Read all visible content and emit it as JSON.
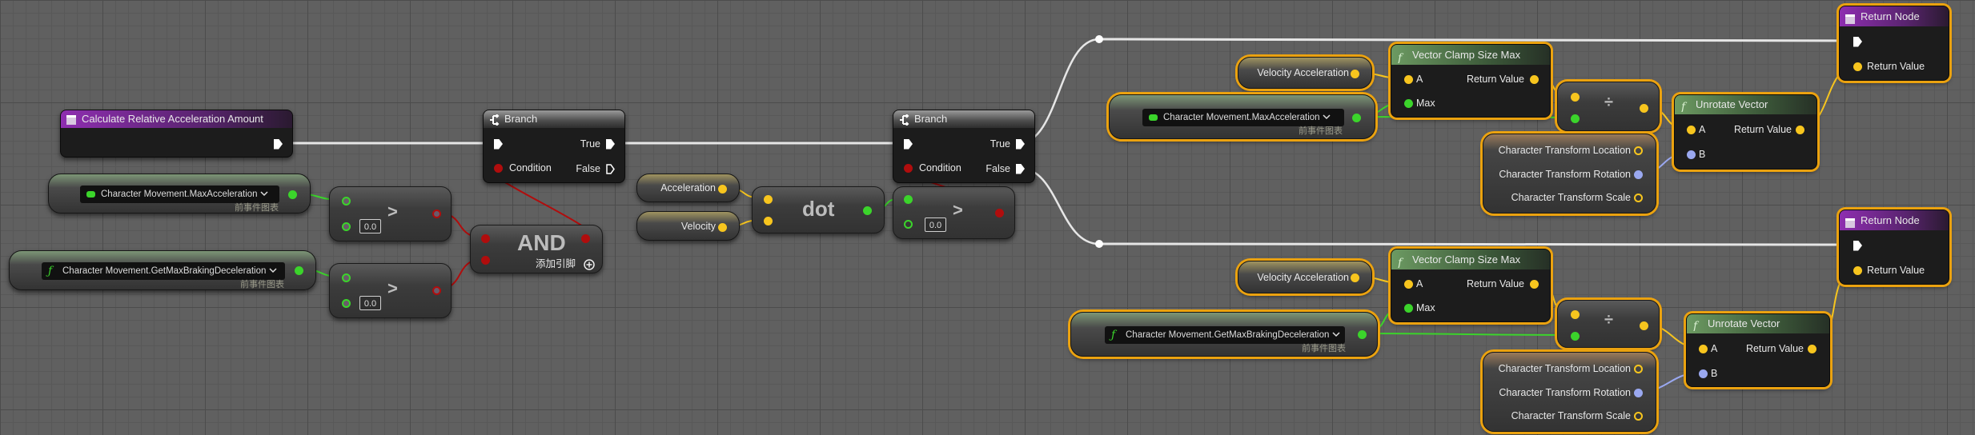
{
  "graph": {
    "event": {
      "title": "Calculate Relative Acceleration Amount"
    },
    "vars": {
      "max_accel": "Character Movement.MaxAcceleration",
      "get_max_braking": "Character Movement.GetMaxBrakingDeceleration",
      "context": "前事件图表",
      "acceleration": "Acceleration",
      "velocity": "Velocity",
      "velocity_accel": "Velocity Acceleration"
    },
    "branch": {
      "title": "Branch",
      "true": "True",
      "false": "False",
      "condition": "Condition"
    },
    "compare": {
      "op": ">",
      "default": "0.0"
    },
    "and": {
      "title": "AND",
      "add_pin": "添加引脚"
    },
    "dot": {
      "title": "dot"
    },
    "clamp": {
      "title": "Vector Clamp Size Max",
      "a": "A",
      "max": "Max",
      "ret": "Return Value"
    },
    "divide": {
      "op": "÷"
    },
    "transform": {
      "location": "Character Transform Location",
      "rotation": "Character Transform Rotation",
      "scale": "Character Transform Scale"
    },
    "unrotate": {
      "title": "Unrotate Vector",
      "a": "A",
      "b": "B",
      "ret": "Return Value"
    },
    "return_node": {
      "title": "Return Node",
      "ret": "Return Value"
    }
  },
  "colors": {
    "exec": "#ffffff",
    "bool": "#b00d0d",
    "float": "#3bd42b",
    "vector": "#f7c51e",
    "rotator": "#9aa8f0",
    "selection": "#eba20f",
    "event_header": "#8e2eb0",
    "function_header": "#6c9a62"
  },
  "icons": {
    "event": "event-icon",
    "branch": "branch-icon",
    "function": "function-icon",
    "variable": "variable-icon",
    "add": "add-pin-icon"
  }
}
